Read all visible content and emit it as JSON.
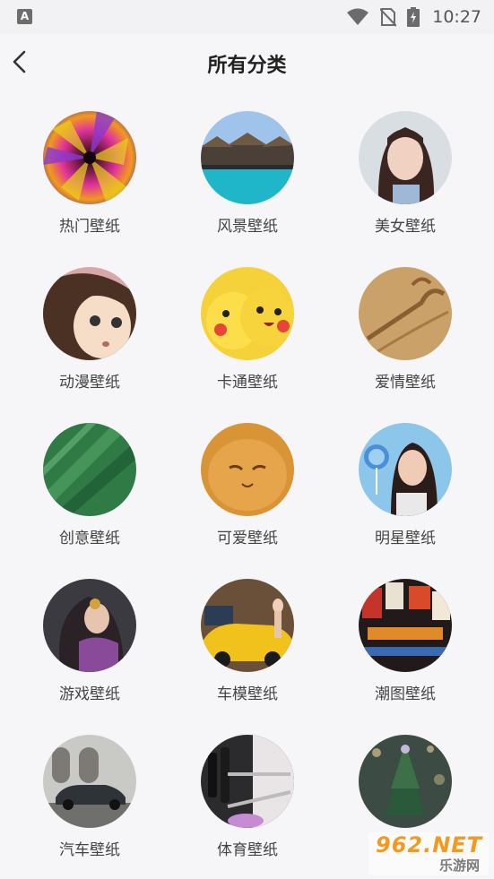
{
  "status_bar": {
    "app_icon_letter": "A",
    "time": "10:27",
    "icons": [
      "wifi-icon",
      "no-sim-icon",
      "battery-charging-icon"
    ]
  },
  "header": {
    "back_icon": "chevron-left-icon",
    "title": "所有分类"
  },
  "categories": [
    {
      "label": "热门壁纸"
    },
    {
      "label": "风景壁纸"
    },
    {
      "label": "美女壁纸"
    },
    {
      "label": "动漫壁纸"
    },
    {
      "label": "卡通壁纸"
    },
    {
      "label": "爱情壁纸"
    },
    {
      "label": "创意壁纸"
    },
    {
      "label": "可爱壁纸"
    },
    {
      "label": "明星壁纸"
    },
    {
      "label": "游戏壁纸"
    },
    {
      "label": "车模壁纸"
    },
    {
      "label": "潮图壁纸"
    },
    {
      "label": "汽车壁纸"
    },
    {
      "label": "体育壁纸"
    },
    {
      "label": ""
    }
  ],
  "watermark": {
    "main": "962.NET",
    "sub": "乐游网"
  }
}
